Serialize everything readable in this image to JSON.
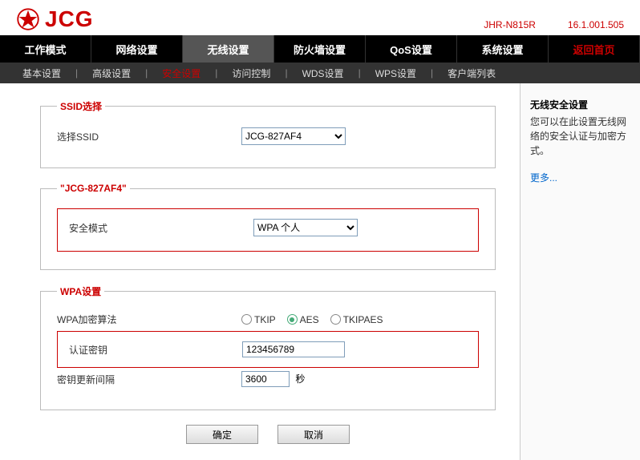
{
  "logo": {
    "text": "JCG"
  },
  "header": {
    "model": "JHR-N815R",
    "version": "16.1.001.505"
  },
  "mainNav": {
    "items": [
      {
        "label": "工作模式"
      },
      {
        "label": "网络设置"
      },
      {
        "label": "无线设置"
      },
      {
        "label": "防火墙设置"
      },
      {
        "label": "QoS设置"
      },
      {
        "label": "系统设置"
      }
    ],
    "return": "返回首页"
  },
  "subNav": {
    "items": [
      {
        "label": "基本设置"
      },
      {
        "label": "高级设置"
      },
      {
        "label": "安全设置"
      },
      {
        "label": "访问控制"
      },
      {
        "label": "WDS设置"
      },
      {
        "label": "WPS设置"
      },
      {
        "label": "客户端列表"
      }
    ]
  },
  "ssidSection": {
    "legend": "SSID选择",
    "label": "选择SSID",
    "value": "JCG-827AF4"
  },
  "securitySection": {
    "legend": "\"JCG-827AF4\"",
    "label": "安全模式",
    "value": "WPA 个人"
  },
  "wpaSection": {
    "legend": "WPA设置",
    "algoLabel": "WPA加密算法",
    "algoOptions": {
      "tkip": "TKIP",
      "aes": "AES",
      "tkipaes": "TKIPAES"
    },
    "keyLabel": "认证密钥",
    "keyValue": "123456789",
    "intervalLabel": "密钥更新间隔",
    "intervalValue": "3600",
    "intervalSuffix": "秒"
  },
  "buttons": {
    "ok": "确定",
    "cancel": "取消"
  },
  "sidebar": {
    "title": "无线安全设置",
    "text": "您可以在此设置无线网络的安全认证与加密方式。",
    "more": "更多..."
  }
}
